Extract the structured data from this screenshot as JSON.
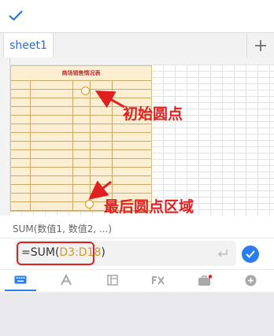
{
  "tabs": {
    "items": [
      {
        "label": "sheet1"
      }
    ]
  },
  "sheet": {
    "table_title": "商场销售情况表"
  },
  "annotations": {
    "start_label": "初始圆点",
    "end_label": "最后圆点区域"
  },
  "function_hint": {
    "text": "SUM(数值1, 数值2, ...)"
  },
  "formula": {
    "prefix": "=SUM(",
    "range": "D3:D18",
    "suffix": ")"
  },
  "toolbar": {
    "items": [
      "keyboard-icon",
      "font-icon",
      "table-layout-icon",
      "fx-icon",
      "toolbox-icon",
      "add-circle-icon"
    ]
  },
  "colors": {
    "accent": "#2b7cf0",
    "annotation": "#e02020",
    "range": "#d9951f"
  }
}
